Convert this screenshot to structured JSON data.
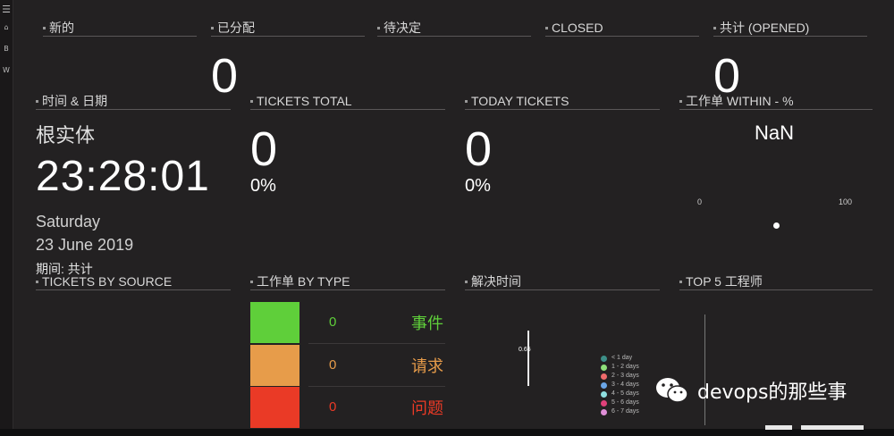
{
  "sidebar": {
    "items": [
      {
        "icon": "menu-icon",
        "glyph": "☰"
      },
      {
        "icon": "home-icon",
        "glyph": "⌂"
      },
      {
        "icon": "b-icon",
        "glyph": "B"
      },
      {
        "icon": "w-icon",
        "glyph": "W"
      }
    ]
  },
  "row1": {
    "new": {
      "title": "新的"
    },
    "assigned": {
      "title": "已分配",
      "value": "0"
    },
    "pending": {
      "title": "待决定"
    },
    "closed": {
      "title": "CLOSED"
    },
    "opened": {
      "title": "共计 (OPENED)",
      "value": "0"
    }
  },
  "clock": {
    "title": "时间 & 日期",
    "entity": "根实体",
    "time": "23:28:01",
    "weekday": "Saturday",
    "date": "23 June 2019",
    "period": "期间: 共计"
  },
  "tickets_total": {
    "title": "TICKETS TOTAL",
    "value": "0",
    "percent": "0%"
  },
  "today_tickets": {
    "title": "TODAY TICKETS",
    "value": "0",
    "percent": "0%"
  },
  "within": {
    "title": "工作单 WITHIN - %",
    "value": "NaN",
    "min": "0",
    "max": "100"
  },
  "row3": {
    "by_source": {
      "title": "TICKETS BY SOURCE"
    },
    "by_type": {
      "title": "工作单 BY TYPE",
      "rows": [
        {
          "count": "0",
          "label": "事件",
          "color": "#5fcf3a"
        },
        {
          "count": "0",
          "label": "请求",
          "color": "#e79c4a"
        },
        {
          "count": "0",
          "label": "问题",
          "color": "#ea3a26"
        }
      ]
    },
    "resolve": {
      "title": "解决时间",
      "value_label": "0.65"
    },
    "top5": {
      "title": "TOP 5 工程师"
    }
  },
  "legend": [
    {
      "label": "< 1 day",
      "color": "#3d8f88"
    },
    {
      "label": "1 - 2 days",
      "color": "#8fe07a"
    },
    {
      "label": "2 - 3 days",
      "color": "#ef6b6b"
    },
    {
      "label": "3 - 4 days",
      "color": "#6aa6e8"
    },
    {
      "label": "4 - 5 days",
      "color": "#8fe0e0"
    },
    {
      "label": "5 - 6 days",
      "color": "#e0407a"
    },
    {
      "label": "6 - 7 days",
      "color": "#e08fd8"
    }
  ],
  "watermark": {
    "text": "devops的那些事"
  }
}
